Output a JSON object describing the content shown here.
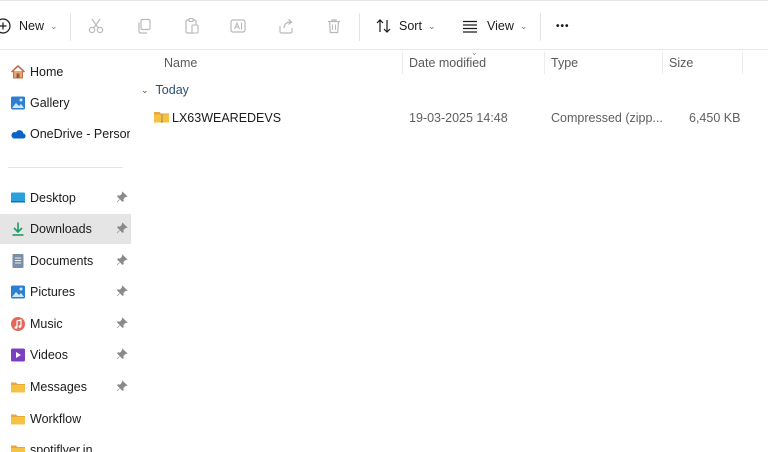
{
  "toolbar": {
    "new_label": "New",
    "sort_label": "Sort",
    "view_label": "View",
    "more_label": "•••",
    "icons": [
      "plus-circle-icon",
      "cut-icon",
      "copy-icon",
      "paste-icon",
      "rename-icon",
      "share-icon",
      "delete-icon",
      "sort-icon",
      "view-icon",
      "more-icon"
    ]
  },
  "sidebar": {
    "quick": [
      {
        "label": "Home",
        "icon": "home-icon"
      },
      {
        "label": "Gallery",
        "icon": "gallery-icon"
      },
      {
        "label": "OneDrive - Persona",
        "icon": "onedrive-icon"
      }
    ],
    "pinned": [
      {
        "label": "Desktop",
        "icon": "desktop-icon",
        "pinned": true
      },
      {
        "label": "Downloads",
        "icon": "downloads-icon",
        "pinned": true,
        "selected": true
      },
      {
        "label": "Documents",
        "icon": "documents-icon",
        "pinned": true
      },
      {
        "label": "Pictures",
        "icon": "pictures-icon",
        "pinned": true
      },
      {
        "label": "Music",
        "icon": "music-icon",
        "pinned": true
      },
      {
        "label": "Videos",
        "icon": "videos-icon",
        "pinned": true
      },
      {
        "label": "Messages",
        "icon": "folder-icon",
        "pinned": true
      },
      {
        "label": "Workflow",
        "icon": "folder-icon",
        "pinned": false
      },
      {
        "label": "spotiflyer.in",
        "icon": "folder-icon",
        "pinned": false
      }
    ]
  },
  "columns": {
    "name": "Name",
    "date": "Date modified",
    "type": "Type",
    "size": "Size"
  },
  "group": {
    "label": "Today"
  },
  "files": [
    {
      "name": "LX63WEAREDEVS",
      "date": "19-03-2025 14:48",
      "type": "Compressed (zipp...",
      "size": "6,450 KB",
      "icon": "zip-folder-icon"
    }
  ],
  "colors": {
    "selected_bg": "#e5e5e5",
    "folder_yellow": "#f5c344",
    "accent_blue": "#0a64c8"
  }
}
